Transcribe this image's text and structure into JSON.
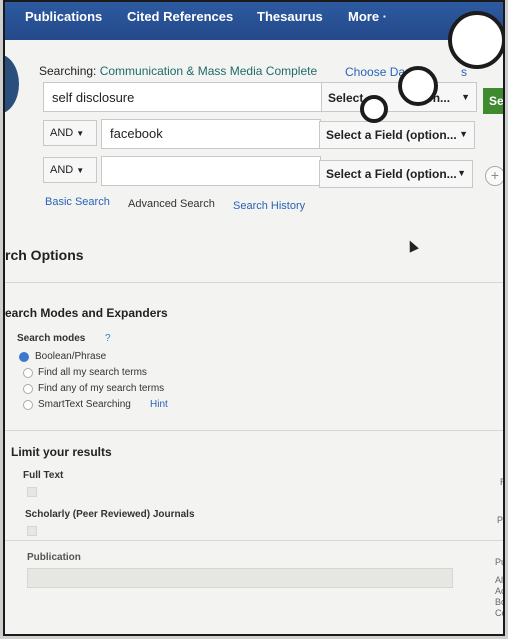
{
  "nav": {
    "publications": "Publications",
    "cited_references": "Cited References",
    "thesaurus": "Thesaurus",
    "more": "More ·"
  },
  "search": {
    "searching_label": "Searching:",
    "database": "Communication & Mass Media Complete",
    "choose_databases": "Choose Da",
    "choose_databases_tail": "s",
    "row1": {
      "value": "self disclosure",
      "field": "Select",
      "field_tail": "on...",
      "button": "Se"
    },
    "row2": {
      "operator": "AND",
      "value": "facebook",
      "field": "Select a Field (option..."
    },
    "row3": {
      "operator": "AND",
      "value": "",
      "field": "Select a Field (option..."
    },
    "add_row": "+"
  },
  "links": {
    "basic_search": "Basic Search",
    "advanced_search": "Advanced Search",
    "search_history": "Search History"
  },
  "options": {
    "title": "rch Options",
    "modes_title": "earch Modes and Expanders",
    "modes_label": "Search modes",
    "help": "?",
    "modes": [
      "Boolean/Phrase",
      "Find all my search terms",
      "Find any of my search terms",
      "SmartText Searching"
    ],
    "hint": "Hint",
    "limit_title": "Limit your results",
    "full_text": "Full Text",
    "scholarly": "Scholarly (Peer Reviewed) Journals",
    "publication": "Publication",
    "edge_r": "R",
    "edge_p1": "Pu",
    "edge_p2": "Pu",
    "edge_list": [
      "Al",
      "Ac",
      "Bo",
      "Co"
    ]
  }
}
